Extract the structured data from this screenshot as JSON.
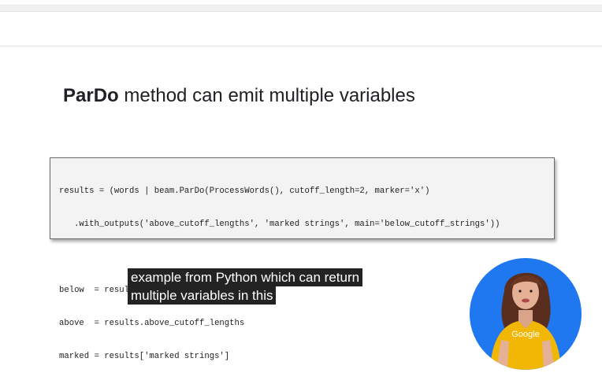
{
  "slide": {
    "title_bold": "ParDo",
    "title_rest": " method can emit multiple variables",
    "code_lines": [
      "results = (words | beam.ParDo(ProcessWords(), cutoff_length=2, marker='x')",
      "   .with_outputs('above_cutoff_lengths', 'marked strings', main='below_cutoff_strings'))",
      "",
      "below  = results.below_cutoff_strings",
      "above  = results.above_cutoff_lengths",
      "marked = results['marked strings']"
    ]
  },
  "captions": {
    "line1": "example from Python which can return",
    "line2": "multiple variables in this"
  },
  "presenter": {
    "shirt_logo": "Google",
    "background_color": "#1f78f0",
    "shirt_color": "#f2b705"
  }
}
